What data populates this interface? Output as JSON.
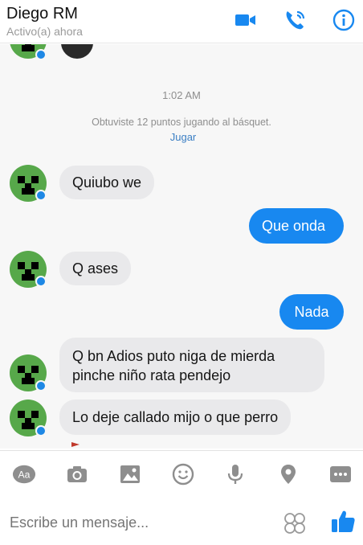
{
  "header": {
    "name": "Diego RM",
    "status": "Activo(a) ahora"
  },
  "chat": {
    "timestamp": "1:02 AM",
    "game_notice": "Obtuviste 12 puntos jugando al básquet.",
    "game_link": "Jugar",
    "messages": [
      {
        "side": "in",
        "text": "Quiubo we"
      },
      {
        "side": "out",
        "text": "Que onda"
      },
      {
        "side": "in",
        "text": "Q ases"
      },
      {
        "side": "out",
        "text": "Nada"
      },
      {
        "side": "in",
        "text": "Q bn Adios puto niga de mierda pinche niño rata pendejo"
      },
      {
        "side": "in",
        "text": "Lo deje callado mijo o que perro"
      }
    ]
  },
  "composer": {
    "aa_label": "Aa",
    "placeholder": "Escribe un mensaje..."
  },
  "colors": {
    "accent": "#1888f0",
    "incoming_bubble": "#e9e9eb",
    "avatar_green": "#57a84a"
  }
}
